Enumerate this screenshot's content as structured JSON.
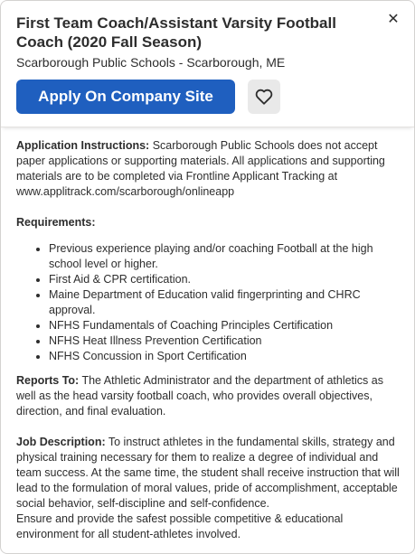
{
  "header": {
    "title": "First Team Coach/Assistant Varsity Football Coach (2020 Fall Season)",
    "company": "Scarborough Public Schools - Scarborough, ME",
    "apply_label": "Apply On Company Site",
    "close_icon": "close-icon",
    "save_icon": "heart-icon"
  },
  "body": {
    "instructions_heading": "Application Instructions:",
    "instructions_text": " Scarborough Public Schools does not accept paper applications or supporting materials. All applications and supporting materials are to be completed via Frontline Applicant Tracking at www.applitrack.com/scarborough/onlineapp",
    "requirements_heading": "Requirements:",
    "requirements": [
      "Previous experience playing and/or coaching Football at the high school level or higher.",
      "First Aid & CPR certification.",
      "Maine Department of Education valid fingerprinting and CHRC approval.",
      "NFHS Fundamentals of Coaching Principles Certification",
      "NFHS Heat Illness Prevention Certification",
      "NFHS Concussion in Sport Certification"
    ],
    "reports_heading": "Reports To:",
    "reports_text": " The Athletic Administrator and the department of athletics as well as the head varsity football coach, who provides overall objectives, direction, and final evaluation.",
    "job_heading": "Job Description:",
    "job_text": " To instruct athletes in the fundamental skills, strategy and physical training necessary for them to realize a degree of individual and team success. At the same time, the student shall receive instruction that will lead to the formulation of moral values, pride of accomplishment, acceptable social behavior, self-discipline and self-confidence.",
    "job_text_2": "Ensure and provide the safest possible competitive & educational environment for all student-athletes involved."
  },
  "colors": {
    "apply_button": "#1f5fbf",
    "save_button_bg": "#e9e9e9"
  }
}
